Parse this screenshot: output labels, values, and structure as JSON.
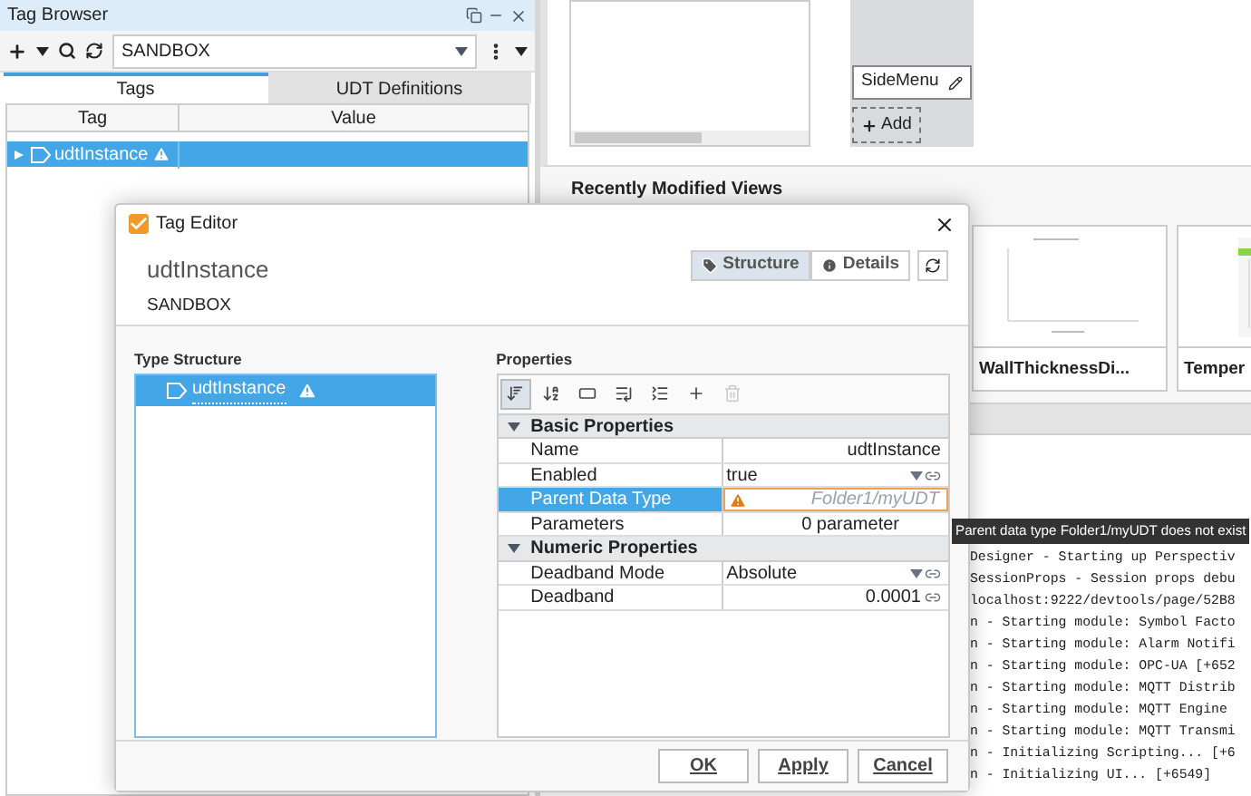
{
  "tag_browser": {
    "title": "Tag Browser",
    "provider": "SANDBOX",
    "tabs": [
      {
        "label": "Tags",
        "selected": true
      },
      {
        "label": "UDT Definitions",
        "selected": false
      }
    ],
    "columns": [
      "Tag",
      "Value"
    ],
    "rows": [
      {
        "name": "udtInstance",
        "warning": true,
        "selected": true
      }
    ]
  },
  "designer": {
    "menu_item": "SideMenu",
    "add_button": "Add",
    "recent_heading": "Recently Modified Views",
    "views": [
      {
        "name": "WallThicknessDi...",
        "kind": "chart"
      },
      {
        "name": "Temper",
        "kind": "table"
      }
    ],
    "console": [
      "Designer - Starting up Perspectiv",
      "SessionProps - Session props debu",
      "localhost:9222/devtools/page/52B8",
      "n - Starting module: Symbol Facto",
      "n - Starting module: Alarm Notifi",
      "n - Starting module: OPC-UA [+652",
      "n - Starting module: MQTT Distrib",
      "n - Starting module: MQTT Engine",
      "n - Starting module: MQTT Transmi",
      "n - Initializing Scripting... [+6",
      "n - Initializing UI... [+6549]"
    ]
  },
  "tag_editor": {
    "title": "Tag Editor",
    "tag_name": "udtInstance",
    "provider": "SANDBOX",
    "view_modes": [
      {
        "label": "Structure",
        "kind": "tag",
        "selected": true
      },
      {
        "label": "Details",
        "kind": "info",
        "selected": false
      }
    ],
    "type_structure": {
      "heading": "Type Structure",
      "items": [
        {
          "name": "udtInstance",
          "warning": true,
          "selected": true
        }
      ]
    },
    "properties": {
      "heading": "Properties",
      "toolbar": [
        {
          "kind": "sort-category",
          "selected": true,
          "disabled": false
        },
        {
          "kind": "sort-alpha",
          "selected": false,
          "disabled": false
        },
        {
          "kind": "field",
          "selected": false,
          "disabled": false
        },
        {
          "kind": "expand",
          "selected": false,
          "disabled": false
        },
        {
          "kind": "collapse",
          "selected": false,
          "disabled": false
        },
        {
          "kind": "add",
          "selected": false,
          "disabled": false
        },
        {
          "kind": "delete",
          "selected": false,
          "disabled": true
        }
      ],
      "groups": [
        {
          "name": "Basic Properties",
          "expanded": true,
          "rows": [
            {
              "name": "Name",
              "value": "udtInstance",
              "kind": "text",
              "selected": false
            },
            {
              "name": "Enabled",
              "value": "true",
              "kind": "dropdown",
              "selected": false
            },
            {
              "name": "Parent Data Type",
              "value": "Folder1/myUDT",
              "kind": "error",
              "selected": true
            },
            {
              "name": "Parameters",
              "value": "0 parameter",
              "kind": "parameters",
              "selected": false
            }
          ]
        },
        {
          "name": "Numeric Properties",
          "expanded": true,
          "rows": [
            {
              "name": "Deadband Mode",
              "value": "Absolute",
              "kind": "dropdown",
              "selected": false
            },
            {
              "name": "Deadband",
              "value": "0.0001",
              "kind": "number",
              "selected": false
            }
          ]
        }
      ]
    },
    "buttons": [
      "OK",
      "Apply",
      "Cancel"
    ],
    "tooltip": "Parent data type Folder1/myUDT does not exist"
  }
}
